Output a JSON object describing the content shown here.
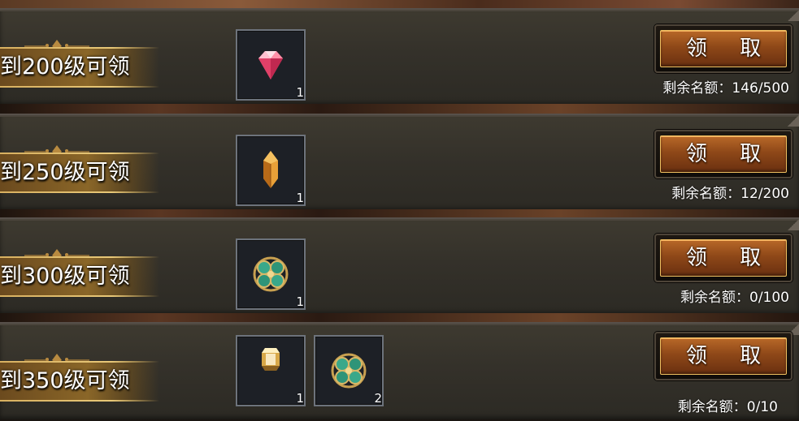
{
  "rows": [
    {
      "level_text": "到200级可领",
      "rewards": [
        {
          "icon": "pink-diamond-icon",
          "count": "1"
        }
      ],
      "claim_label": "领 取",
      "remaining": "剩余名额：146/500"
    },
    {
      "level_text": "到250级可领",
      "rewards": [
        {
          "icon": "amber-crystal-icon",
          "count": "1"
        }
      ],
      "claim_label": "领 取",
      "remaining": "剩余名额：12/200"
    },
    {
      "level_text": "到300级可领",
      "rewards": [
        {
          "icon": "jade-clover-icon",
          "count": "1"
        }
      ],
      "claim_label": "领 取",
      "remaining": "剩余名额：0/100"
    },
    {
      "level_text": "到350级可领",
      "rewards": [
        {
          "icon": "gold-gem-icon",
          "count": "1"
        },
        {
          "icon": "jade-clover-icon",
          "count": "2"
        }
      ],
      "claim_label": "领 取",
      "remaining": "剩余名额：0/10"
    }
  ],
  "colors": {
    "panel": "#34312a",
    "banner_gold": "#8a6628",
    "button_orange": "#8e4818",
    "button_border": "#f0c060"
  }
}
